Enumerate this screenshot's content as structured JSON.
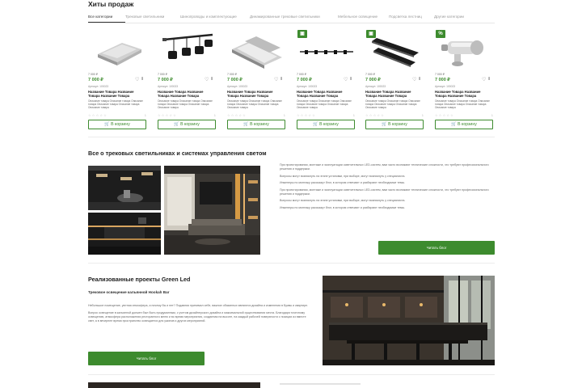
{
  "hits": {
    "title": "Хиты продаж",
    "tabs": [
      {
        "label": "Все категории",
        "active": true
      },
      {
        "label": "Трековые светильники",
        "active": false
      },
      {
        "label": "Шинопроводы и комплектующие",
        "active": false
      },
      {
        "label": "Динамированные трековые светильники",
        "active": false
      },
      {
        "label": "Мебельное освещение",
        "active": false
      },
      {
        "label": "Подсветка лестниц",
        "active": false
      },
      {
        "label": "Другие категории",
        "active": false
      }
    ]
  },
  "products": [
    {
      "badge": "",
      "price_old": "7 000 ₽",
      "price": "7 000 ₽",
      "sku": "Артикул: 100023",
      "name": "Название Товара Название Товара Название Товара",
      "desc": "Описание товара Описание товара Описание товара Описание товара Описание товара Описание товара",
      "qty": "1",
      "cart": "В корзину"
    },
    {
      "badge": "",
      "price_old": "7 000 ₽",
      "price": "7 000 ₽",
      "sku": "Артикул: 100023",
      "name": "Название Товара Название Товара Название Товара",
      "desc": "Описание товара Описание товара Описание товара Описание товара Описание товара Описание товара",
      "qty": "1",
      "cart": "В корзину"
    },
    {
      "badge": "",
      "price_old": "7 000 ₽",
      "price": "7 000 ₽",
      "sku": "Артикул: 100023",
      "name": "Название Товара Название Товара Название Товара",
      "desc": "Описание товара Описание товара Описание товара Описание товара Описание товара Описание товара",
      "qty": "1",
      "cart": "В корзину"
    },
    {
      "badge": "gift",
      "price_old": "7 000 ₽",
      "price": "7 000 ₽",
      "sku": "Артикул: 100023",
      "name": "Название Товара Название Товара Название Товара",
      "desc": "Описание товара Описание товара Описание товара Описание товара Описание товара Описание товара",
      "qty": "1",
      "cart": "В корзину"
    },
    {
      "badge": "gift",
      "price_old": "7 000 ₽",
      "price": "7 000 ₽",
      "sku": "Артикул: 100023",
      "name": "Название Товара Название Товара Название Товара",
      "desc": "Описание товара Описание товара Описание товара Описание товара Описание товара Описание товара",
      "qty": "1",
      "cart": "В корзину"
    },
    {
      "badge": "%",
      "price_old": "7 000 ₽",
      "price": "7 000 ₽",
      "sku": "Артикул: 100023",
      "name": "Название Товара Название Товара Название Товара",
      "desc": "Описание товара Описание товара Описание товара Описание товара Описание товара Описание товара",
      "qty": "1",
      "cart": "В корзину"
    }
  ],
  "about": {
    "title": "Все о трековых светильниках и системах управления светом",
    "paragraphs": [
      "При проектировании, монтаже и эксплуатации осветительных LED-систем, вам часто возникают технические сложности, что требуют профессионального решения и поддержки.",
      "Вопросы могут возникнуть на этапе установки, при выборе, могут возникнуть у специалиста.",
      "Инженеры по монтажу расскажут блог, в котором отвечают и разбирают необходимые темы.",
      "При проектировании, монтаже и эксплуатации осветительных LED-систем, вам часто возникают технические сложности, что требуют профессионального решения и поддержки.",
      "Вопросы могут возникнуть на этапе установки, при выборе, могут возникнуть у специалиста.",
      "Инженеры по монтажу расскажут блог, в котором отвечают и разбирают необходимые темы."
    ],
    "button": "Читать блог"
  },
  "projects": {
    "title": "Реализованные проекты Green Led",
    "subtitle": "Трековое освещение кальянной Hookah Bar",
    "paragraphs": [
      "Небольшое помещение, уютная атмосфера, а почему бы и нет? Подавляя принимал себе, важное обязанных являются дизайна и изменения в Буквы и квартире.",
      "Вопрос освещение в кальянной должен был быть продуманным, с учетом дизайнерского дизайна и максимальной существования места. Благодаря точечному освещению, атмосфера расположения ресторанного меню и во время мероприятия, созданная на высоте, на каждый рабочей поверхности с позиции из вместе свет, а в вечернее время пространство освещается для ужинов и других мероприятий."
    ],
    "button": "Читать блог"
  }
}
